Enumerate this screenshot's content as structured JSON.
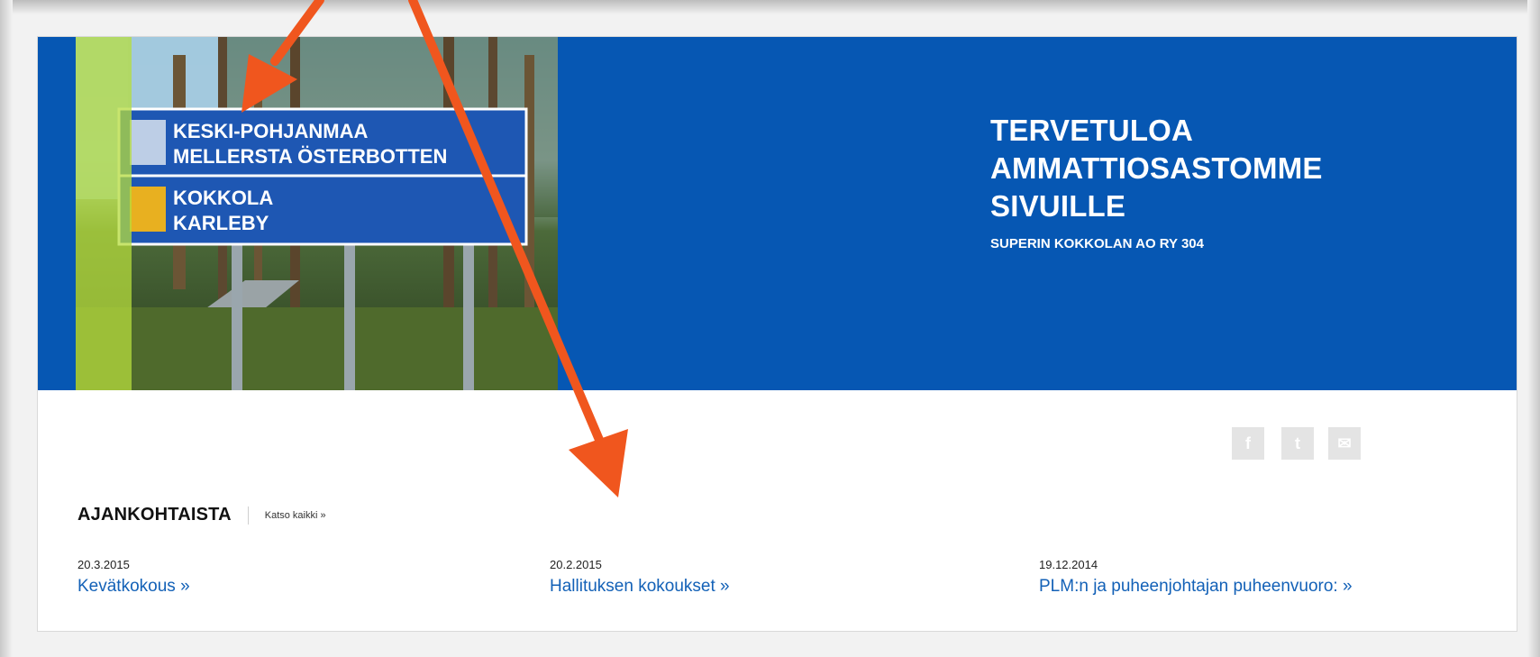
{
  "hero": {
    "sign_line1": "KESKI-POHJANMAA",
    "sign_line2": "MELLERSTA ÖSTERBOTTEN",
    "sign_line3": "KOKKOLA",
    "sign_line4": "KARLEBY",
    "title": "TERVETULOA\nAMMATTIOSASTOMME\nSIVUILLE",
    "subtitle": "SUPERIN KOKKOLAN AO RY 304"
  },
  "social": {
    "facebook": "f",
    "twitter": "t",
    "email": "✉"
  },
  "news": {
    "title": "AJANKOHTAISTA",
    "view_all": "Katso kaikki »",
    "items": [
      {
        "date": "20.3.2015",
        "title": "Kevätkokous »"
      },
      {
        "date": "20.2.2015",
        "title": "Hallituksen kokoukset »"
      },
      {
        "date": "19.12.2014",
        "title": "PLM:n ja puheenjohtajan puheenvuoro: »"
      }
    ]
  },
  "colors": {
    "brand_blue": "#0657b3",
    "link_blue": "#1361b7",
    "annotation_arrow": "#f0561e"
  }
}
